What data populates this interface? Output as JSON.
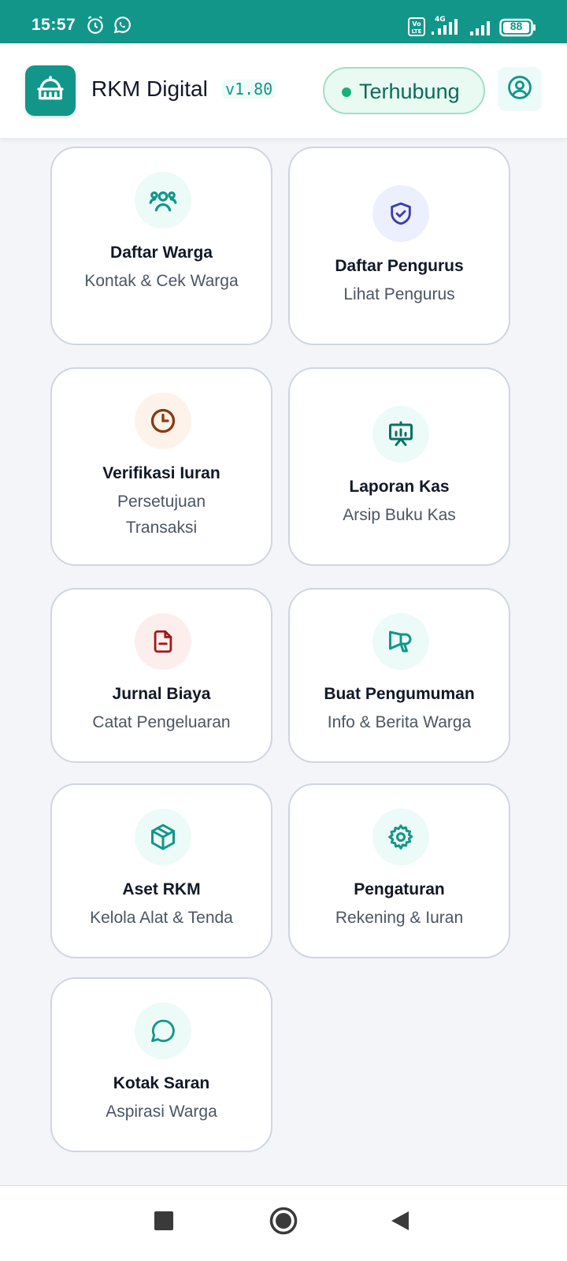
{
  "status_bar": {
    "time": "15:57",
    "network": "4G",
    "volte": "Vo LTE",
    "battery": "88",
    "icons": [
      "alarm-icon",
      "whatsapp-icon",
      "signal-icon",
      "battery-icon"
    ]
  },
  "header": {
    "app_title": "RKM Digital",
    "version": "v1.80",
    "connection_status": "Terhubung",
    "colors": {
      "brand": "#12968a",
      "status_ok": "#16b07a"
    }
  },
  "menu": [
    {
      "title": "Daftar Warga",
      "subtitle": "Kontak & Cek Warga",
      "icon": "users-icon"
    },
    {
      "title": "Daftar Pengurus",
      "subtitle": "Lihat Pengurus",
      "icon": "shield-check-icon"
    },
    {
      "title": "Verifikasi Iuran",
      "subtitle": "Persetujuan Transaksi",
      "icon": "clock-icon"
    },
    {
      "title": "Laporan Kas",
      "subtitle": "Arsip Buku Kas",
      "icon": "presentation-chart-icon"
    },
    {
      "title": "Jurnal Biaya",
      "subtitle": "Catat Pengeluaran",
      "icon": "file-minus-icon"
    },
    {
      "title": "Buat Pengumuman",
      "subtitle": "Info & Berita Warga",
      "icon": "megaphone-icon"
    },
    {
      "title": "Aset RKM",
      "subtitle": "Kelola Alat & Tenda",
      "icon": "box-icon"
    },
    {
      "title": "Pengaturan",
      "subtitle": "Rekening & Iuran",
      "icon": "gear-icon"
    },
    {
      "title": "Kotak Saran",
      "subtitle": "Aspirasi Warga",
      "icon": "chat-bubble-icon"
    }
  ],
  "bottom_nav": [
    "recents-button",
    "home-button",
    "back-button"
  ]
}
